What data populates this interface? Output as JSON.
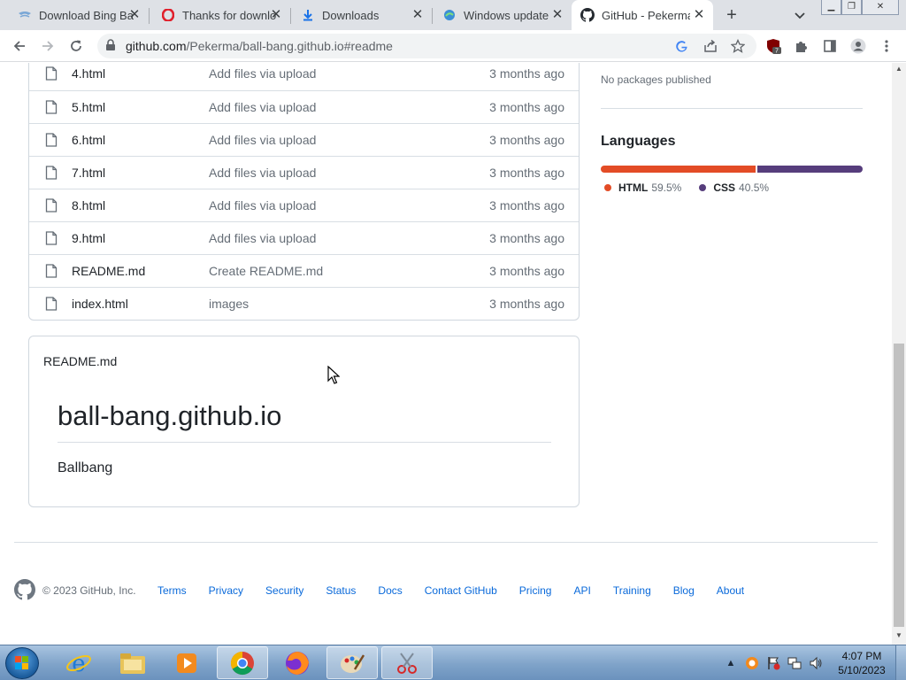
{
  "browser": {
    "tabs": [
      {
        "title": "Download Bing Ba",
        "favicon": "bing-icon",
        "active": false
      },
      {
        "title": "Thanks for downlo",
        "favicon": "opera-icon",
        "active": false
      },
      {
        "title": "Downloads",
        "favicon": "download-icon",
        "active": false
      },
      {
        "title": "Windows update",
        "favicon": "edge-icon",
        "active": false
      },
      {
        "title": "GitHub - Pekerma",
        "favicon": "github-icon",
        "active": true
      }
    ],
    "url_host": "github.com",
    "url_path": "/Pekerma/ball-bang.github.io#readme",
    "extension_badge": "7"
  },
  "files": [
    {
      "name": "4.html",
      "message": "Add files via upload",
      "age": "3 months ago"
    },
    {
      "name": "5.html",
      "message": "Add files via upload",
      "age": "3 months ago"
    },
    {
      "name": "6.html",
      "message": "Add files via upload",
      "age": "3 months ago"
    },
    {
      "name": "7.html",
      "message": "Add files via upload",
      "age": "3 months ago"
    },
    {
      "name": "8.html",
      "message": "Add files via upload",
      "age": "3 months ago"
    },
    {
      "name": "9.html",
      "message": "Add files via upload",
      "age": "3 months ago"
    },
    {
      "name": "README.md",
      "message": "Create README.md",
      "age": "3 months ago"
    },
    {
      "name": "index.html",
      "message": "images",
      "age": "3 months ago"
    }
  ],
  "readme": {
    "label": "README.md",
    "heading": "ball-bang.github.io",
    "body": "Ballbang"
  },
  "sidebar": {
    "packages_text": "No packages published",
    "languages_title": "Languages",
    "languages": [
      {
        "name": "HTML",
        "percent": "59.5%",
        "value": 59.5,
        "color": "#e34c26"
      },
      {
        "name": "CSS",
        "percent": "40.5%",
        "value": 40.5,
        "color": "#563d7c"
      }
    ]
  },
  "footer": {
    "copyright": "© 2023 GitHub, Inc.",
    "links": [
      "Terms",
      "Privacy",
      "Security",
      "Status",
      "Docs",
      "Contact GitHub",
      "Pricing",
      "API",
      "Training",
      "Blog",
      "About"
    ]
  },
  "taskbar": {
    "time": "4:07 PM",
    "date": "5/10/2023",
    "apps": [
      "internet-explorer-icon",
      "file-explorer-icon",
      "media-player-icon",
      "chrome-icon",
      "firefox-icon",
      "paint-icon",
      "snipping-tool-icon"
    ]
  }
}
